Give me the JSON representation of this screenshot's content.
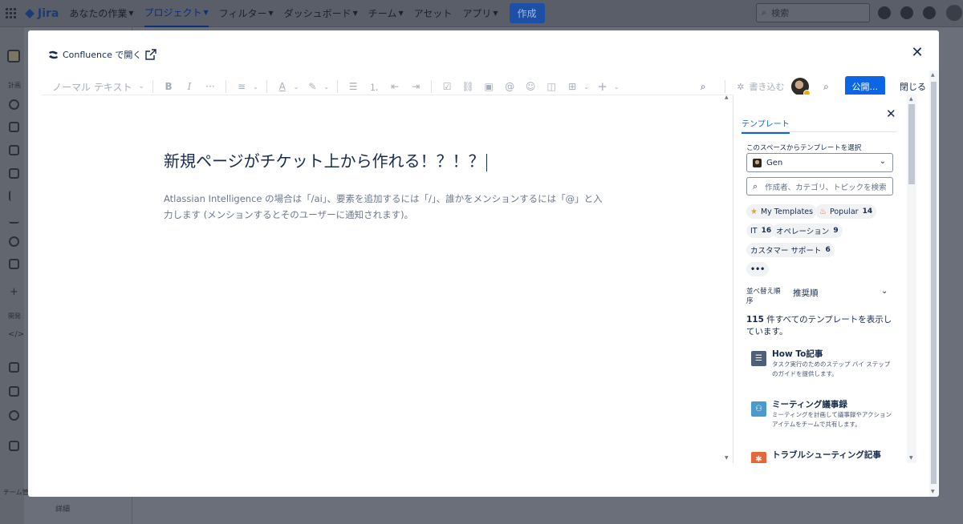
{
  "app": {
    "name": "Jira",
    "nav": [
      "あなたの作業",
      "プロジェクト",
      "フィルター",
      "ダッシュボード",
      "チーム",
      "アセット",
      "アプリ"
    ],
    "create": "作成",
    "search_placeholder": "検索"
  },
  "sidebar": {
    "plan_label": "計画",
    "dev_label": "開発",
    "team_label": "チーム管",
    "detail_label": "詳細"
  },
  "modal": {
    "open_in_confluence": "Confluence で開く",
    "toolbar": {
      "text_style": "ノーマル テキスト",
      "write_ai": "書き込む",
      "publish": "公開...",
      "close": "閉じる"
    },
    "page_title": "新規ページがチケット上から作れる！？！？",
    "placeholder": "Atlassian Intelligence の場合は「/ai」、要素を追加するには「/」、誰かをメンションするには「@」と入力します (メンションするとそのユーザーに通知されます)。"
  },
  "templates": {
    "tab": "テンプレート",
    "space_label": "このスペースからテンプレートを選択",
    "space_value": "Gen",
    "search_placeholder": "作成者、カテゴリ、トピックを検索",
    "chips": [
      {
        "label": "My Templates",
        "count": ""
      },
      {
        "label": "Popular",
        "count": "14"
      },
      {
        "label": "IT",
        "count": "16"
      },
      {
        "label": "オペレーション",
        "count": "9"
      },
      {
        "label": "カスタマー サポート",
        "count": "6"
      },
      {
        "label": "•••",
        "count": ""
      }
    ],
    "sort_label": "並べ替え順序",
    "sort_value": "推奨順",
    "count_number": "115",
    "count_text": " 件すべてのテンプレートを表示しています。",
    "items": [
      {
        "title": "How To記事",
        "desc": "タスク実行のためのステップ バイ ステップのガイドを提供します。",
        "color": "#505f79"
      },
      {
        "title": "ミーティング議事録",
        "desc": "ミーティングを計画して議事録やアクション アイテムをチームで共有します。",
        "color": "#4c9ac9"
      },
      {
        "title": "トラブルシューティング記事",
        "desc": "",
        "color": "#e5683a"
      }
    ]
  }
}
